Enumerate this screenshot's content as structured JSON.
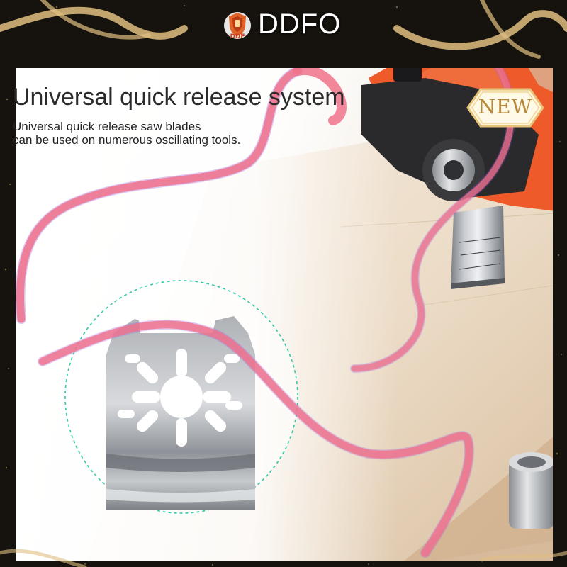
{
  "brand": {
    "logo_text": "DDF",
    "name": "DDFO"
  },
  "badge": {
    "text": "NEW"
  },
  "headline": "Universal quick release system",
  "description": {
    "line1": "Universal quick release saw blades",
    "line2": "can be used on numerous oscillating tools."
  },
  "colors": {
    "ribbon": "#f0728a",
    "ribbon_shadow": "#9b5ce0",
    "tool_body": "#ee5a2a",
    "gold_frame": "#e0bf80",
    "wood": "#ead8c2",
    "circle_outline": "#33c9a6"
  }
}
